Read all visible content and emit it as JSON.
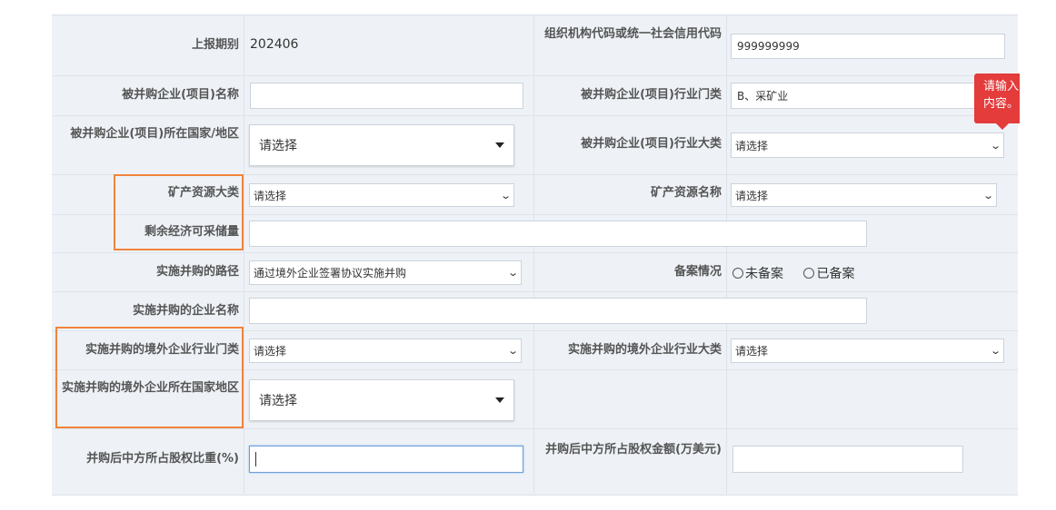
{
  "rows": {
    "report_period_label": "上报期别",
    "report_period_value": "202406",
    "org_code_label": "组织机构代码或统一社会信用代码",
    "org_code_value": "999999999",
    "target_name_label": "被并购企业(项目)名称",
    "target_name_value": "",
    "target_industry_cat_label": "被并购企业(项目)行业门类",
    "target_industry_cat_value": "B、采矿业",
    "target_country_label": "被并购企业(项目)所在国家/地区",
    "target_country_value": "请选择",
    "target_industry_major_label": "被并购企业(项目)行业大类",
    "target_industry_major_value": "请选择",
    "mineral_cat_label": "矿产资源大类",
    "mineral_cat_value": "请选择",
    "mineral_name_label": "矿产资源名称",
    "mineral_name_value": "请选择",
    "reserves_label": "剩余经济可采储量",
    "reserves_value": "",
    "path_label": "实施并购的路径",
    "path_value": "通过境外企业签署协议实施并购",
    "filing_label": "备案情况",
    "filing_options": [
      "未备案",
      "已备案"
    ],
    "acquirer_name_label": "实施并购的企业名称",
    "acquirer_name_value": "",
    "overseas_industry_cat_label": "实施并购的境外企业行业门类",
    "overseas_industry_cat_value": "请选择",
    "overseas_industry_major_label": "实施并购的境外企业行业大类",
    "overseas_industry_major_value": "请选择",
    "overseas_country_label": "实施并购的境外企业所在国家地区",
    "overseas_country_value": "请选择",
    "equity_ratio_label": "并购后中方所占股权比重(%)",
    "equity_ratio_value": "",
    "equity_amount_label": "并购后中方所占股权金额(万美元)",
    "equity_amount_value": ""
  },
  "tooltip": {
    "text": "请输入内容。"
  },
  "colors": {
    "highlight": "#f0843c",
    "tooltip": "#e43b3b",
    "form_bg": "#eef2f7",
    "focus": "#6a9fd8"
  },
  "icons": {
    "select_arrow": "chevron-down-icon",
    "big_select_arrow": "caret-down-icon",
    "radio": "radio-icon"
  }
}
